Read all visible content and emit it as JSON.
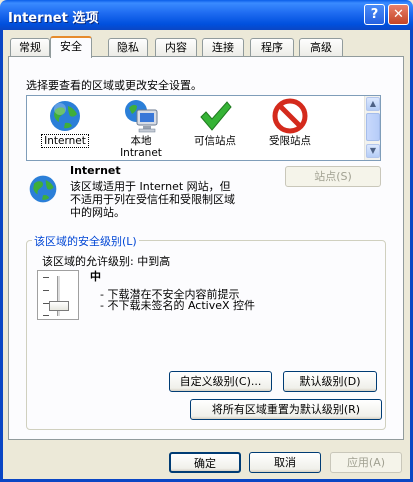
{
  "window": {
    "title": "Internet 选项",
    "help_glyph": "?",
    "close_glyph": "✕"
  },
  "tabs": [
    {
      "label": "常规",
      "active": false
    },
    {
      "label": "安全",
      "active": true
    },
    {
      "label": "隐私",
      "active": false
    },
    {
      "label": "内容",
      "active": false
    },
    {
      "label": "连接",
      "active": false
    },
    {
      "label": "程序",
      "active": false
    },
    {
      "label": "高级",
      "active": false
    }
  ],
  "zone_prompt": "选择要查看的区域或更改安全设置。",
  "zones": [
    {
      "line1": "Internet",
      "line2": "",
      "icon": "globe-icon",
      "selected": true
    },
    {
      "line1": "本地",
      "line2": "Intranet",
      "icon": "intranet-computer-icon",
      "selected": false
    },
    {
      "line1": "可信站点",
      "line2": "",
      "icon": "checkmark-icon",
      "selected": false
    },
    {
      "line1": "受限站点",
      "line2": "",
      "icon": "no-entry-icon",
      "selected": false
    }
  ],
  "detail": {
    "name": "Internet",
    "desc1": "该区域适用于 Internet 网站，但",
    "desc2": "不适用于列在受信任和受限制区域",
    "desc3": "中的网站。",
    "sites_button": "站点(S)"
  },
  "security": {
    "group_title": "该区域的安全级别(L)",
    "allowed_label": "该区域的允许级别: 中到高",
    "level_name": "中",
    "bullet1": "- 下载潜在不安全内容前提示",
    "bullet2": "- 不下载未签名的 ActiveX 控件",
    "custom_button": "自定义级别(C)...",
    "default_button": "默认级别(D)",
    "reset_all_button": "将所有区域重置为默认级别(R)",
    "slider_level": 0.25
  },
  "footer": {
    "ok": "确定",
    "cancel": "取消",
    "apply": "应用(A)"
  }
}
